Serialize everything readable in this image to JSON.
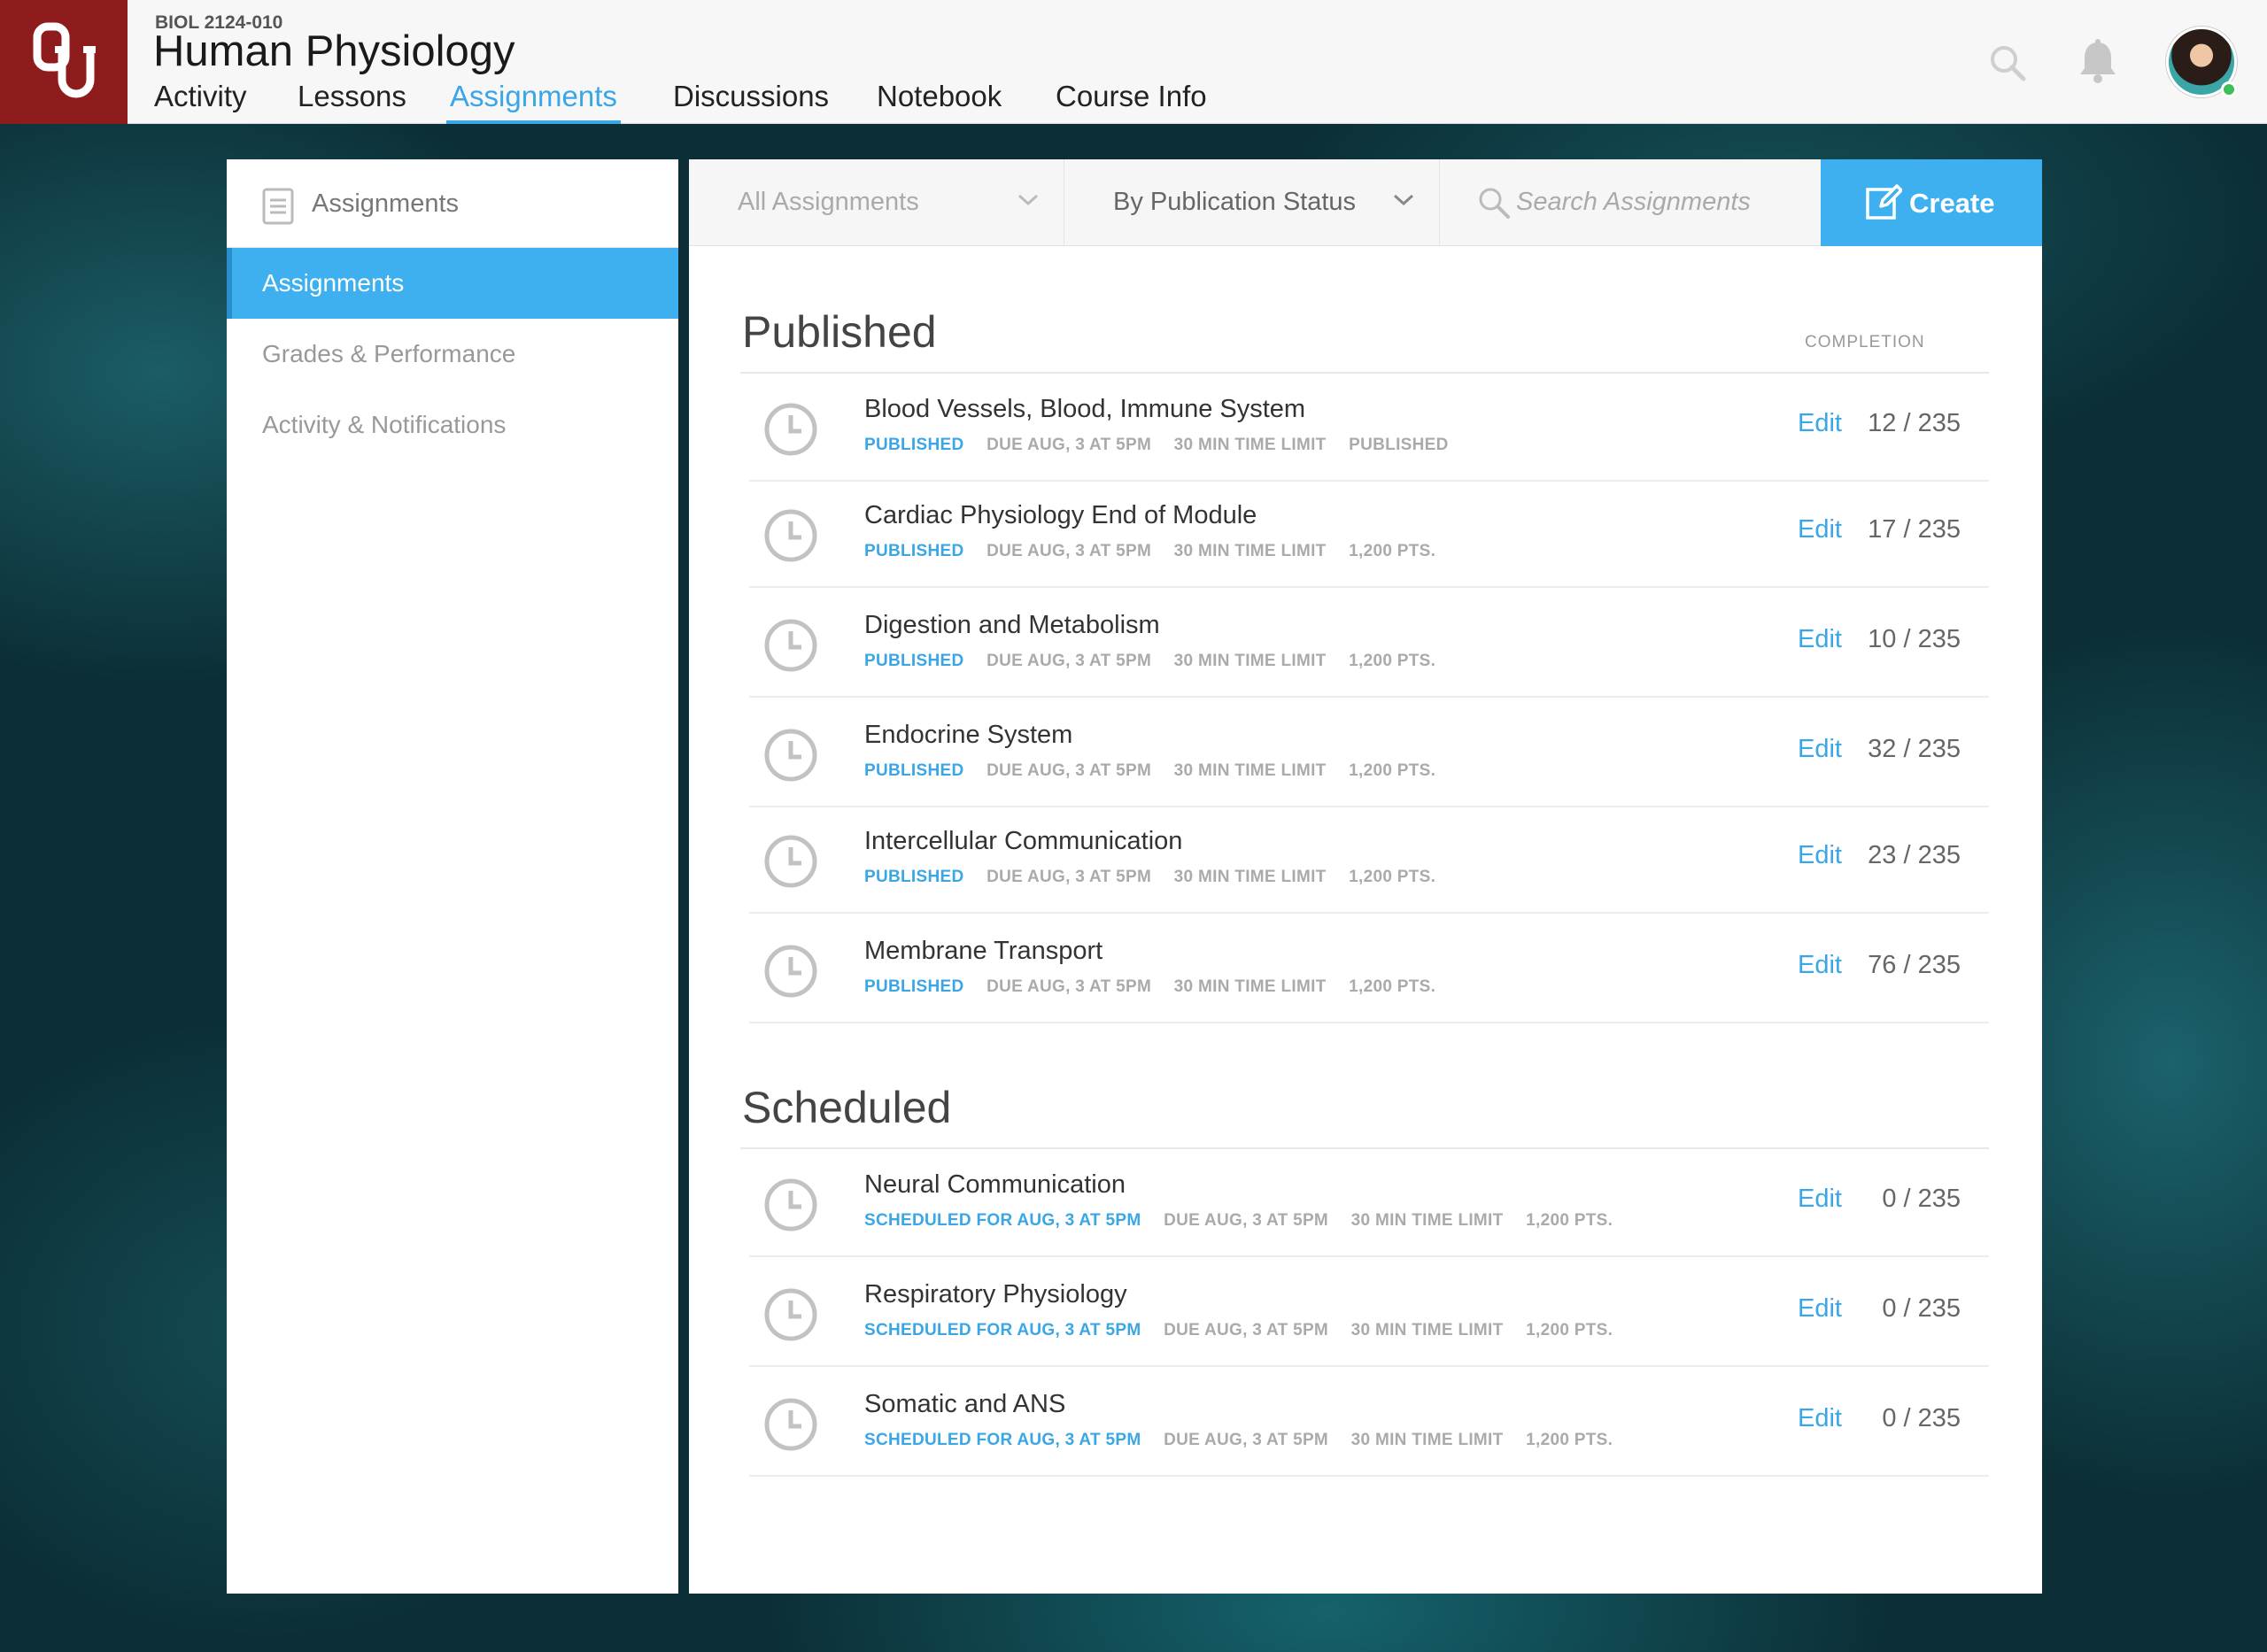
{
  "header": {
    "course_code": "BIOL 2124-010",
    "course_title": "Human Physiology",
    "nav": [
      {
        "label": "Activity"
      },
      {
        "label": "Lessons"
      },
      {
        "label": "Assignments"
      },
      {
        "label": "Discussions"
      },
      {
        "label": "Notebook"
      },
      {
        "label": "Course Info"
      }
    ],
    "active_nav": "Assignments"
  },
  "sidebar": {
    "title": "Assignments",
    "items": [
      {
        "label": "Assignments"
      },
      {
        "label": "Grades & Performance"
      },
      {
        "label": "Activity & Notifications"
      }
    ]
  },
  "toolbar": {
    "filter_value": "All Assignments",
    "sort_value": "By Publication Status",
    "search_placeholder": "Search Assignments",
    "create_label": "Create"
  },
  "list": {
    "completion_header": "COMPLETION",
    "edit_label": "Edit",
    "sections": [
      {
        "title": "Published",
        "rows": [
          {
            "title": "Blood Vessels, Blood, Immune System",
            "status": "PUBLISHED",
            "due": "DUE AUG, 3 AT 5PM",
            "limit": "30 MIN TIME LIMIT",
            "extra": "PUBLISHED",
            "completion": "12 / 235"
          },
          {
            "title": "Cardiac Physiology End of Module",
            "status": "PUBLISHED",
            "due": "DUE AUG, 3 AT 5PM",
            "limit": "30 MIN TIME LIMIT",
            "extra": "1,200 PTS.",
            "completion": "17 / 235"
          },
          {
            "title": "Digestion and Metabolism",
            "status": "PUBLISHED",
            "due": "DUE AUG, 3 AT 5PM",
            "limit": "30 MIN TIME LIMIT",
            "extra": "1,200 PTS.",
            "completion": "10 / 235"
          },
          {
            "title": "Endocrine System",
            "status": "PUBLISHED",
            "due": "DUE AUG, 3 AT 5PM",
            "limit": "30 MIN TIME LIMIT",
            "extra": "1,200 PTS.",
            "completion": "32 / 235"
          },
          {
            "title": "Intercellular Communication",
            "status": "PUBLISHED",
            "due": "DUE AUG, 3 AT 5PM",
            "limit": "30 MIN TIME LIMIT",
            "extra": "1,200 PTS.",
            "completion": "23 / 235"
          },
          {
            "title": "Membrane Transport",
            "status": "PUBLISHED",
            "due": "DUE AUG, 3 AT 5PM",
            "limit": "30 MIN TIME LIMIT",
            "extra": "1,200 PTS.",
            "completion": "76 / 235"
          }
        ]
      },
      {
        "title": "Scheduled",
        "rows": [
          {
            "title": "Neural Communication",
            "status": "SCHEDULED FOR AUG, 3 AT 5PM",
            "due": "DUE AUG, 3 AT 5PM",
            "limit": "30 MIN TIME LIMIT",
            "extra": "1,200 PTS.",
            "completion": "0 / 235"
          },
          {
            "title": "Respiratory Physiology",
            "status": "SCHEDULED FOR AUG, 3 AT 5PM",
            "due": "DUE AUG, 3 AT 5PM",
            "limit": "30 MIN TIME LIMIT",
            "extra": "1,200 PTS.",
            "completion": "0 / 235"
          },
          {
            "title": "Somatic and ANS",
            "status": "SCHEDULED FOR AUG, 3 AT 5PM",
            "due": "DUE AUG, 3 AT 5PM",
            "limit": "30 MIN TIME LIMIT",
            "extra": "1,200 PTS.",
            "completion": "0 / 235"
          }
        ]
      }
    ]
  },
  "colors": {
    "brand": "#8e1c1c",
    "accent": "#3aa6e6",
    "create_button": "#3fb0ef",
    "online_status": "#3fbf5a"
  },
  "icons": [
    "university-logo",
    "search-icon",
    "bell-icon",
    "avatar",
    "document-icon",
    "chevron-down-icon",
    "edit-icon",
    "clock-icon"
  ]
}
